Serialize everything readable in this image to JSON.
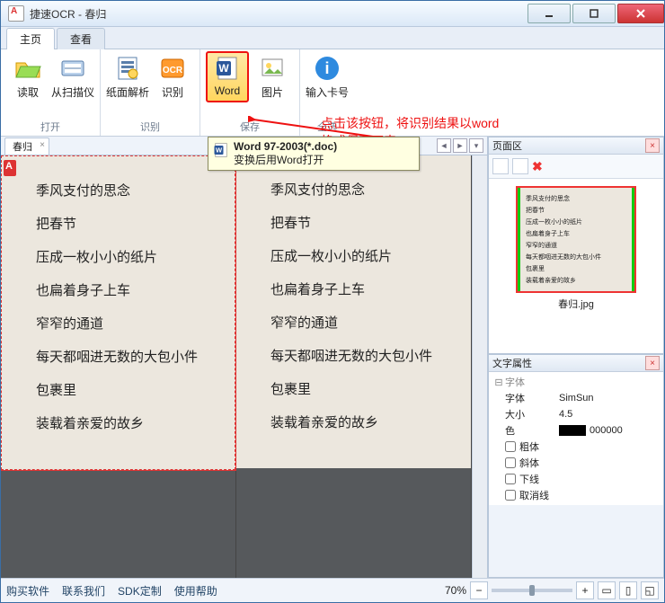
{
  "window": {
    "title": "捷速OCR - 春归"
  },
  "tabs": {
    "home": "主页",
    "view": "查看"
  },
  "ribbon": {
    "open_group": "打开",
    "read": "读取",
    "scanner": "从扫描仪",
    "recog_group": "识别",
    "page_parse": "纸面解析",
    "recognize": "识别",
    "save_group": "保存",
    "word": "Word",
    "picture": "图片",
    "selectall_group": "全选",
    "input_card": "输入卡号"
  },
  "annotation": {
    "line1": "点击该按钮，将识别结果以word",
    "line2": "格式保存下来"
  },
  "tooltip": {
    "title": "Word 97-2003(*.doc)",
    "desc": "变换后用Word打开"
  },
  "doc": {
    "tab": "春归",
    "lines": [
      "季风支付的思念",
      "把春节",
      "压成一枚小小的纸片",
      "也扁着身子上车",
      "窄窄的通道",
      "每天都咽进无数的大包小件",
      "包裹里",
      "装载着亲爱的故乡"
    ],
    "lines_right_last": "装载着亲爱的故乡"
  },
  "side": {
    "pages_panel": "页面区",
    "thumb_caption": "春归.jpg",
    "thumb_lines": [
      "季风支付的思念",
      "把春节",
      "压成一枚小小的纸片",
      "也扁着身子上车",
      "窄窄的通道",
      "每天都咽进无数的大包小件",
      "包裹里",
      "装载着亲爱的故乡"
    ],
    "props_panel": "文字属性",
    "font_group": "字体",
    "font_name_k": "字体",
    "font_name_v": "SimSun",
    "font_size_k": "大小",
    "font_size_v": "4.5",
    "color_k": "色",
    "color_v": "000000",
    "bold": "粗体",
    "italic": "斜体",
    "underline": "下线",
    "strike": "取消线"
  },
  "status": {
    "buy": "购买软件",
    "contact": "联系我们",
    "sdk": "SDK定制",
    "help": "使用帮助",
    "zoom": "70%"
  }
}
